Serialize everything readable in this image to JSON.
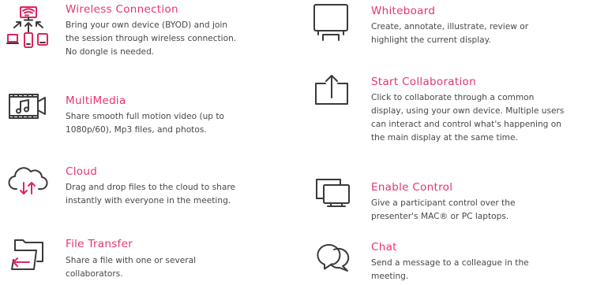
{
  "colors": {
    "accent": "#e0245e",
    "title": "#e8336d",
    "text": "#474747",
    "icon": "#3a3a3a"
  },
  "features": {
    "wireless": {
      "icon": "wireless-devices-icon",
      "title": "Wireless Connection",
      "lines": [
        "Bring your own device (BYOD) and join",
        "the session through wireless connection.",
        "No dongle is needed."
      ]
    },
    "multimedia": {
      "icon": "multimedia-icon",
      "title": "MultiMedia",
      "lines": [
        "Share smooth full motion video (up to",
        "1080p/60), Mp3 files, and photos."
      ]
    },
    "cloud": {
      "icon": "cloud-icon",
      "title": "Cloud",
      "lines": [
        "Drag and drop files to the cloud to share",
        "instantly with everyone in the meeting."
      ]
    },
    "file_transfer": {
      "icon": "folder-transfer-icon",
      "title": "File Transfer",
      "lines": [
        "Share a file with one or several",
        "collaborators."
      ]
    },
    "whiteboard": {
      "icon": "whiteboard-icon",
      "title": "Whiteboard",
      "lines": [
        "Create, annotate, illustrate, review or",
        "highlight the current display."
      ]
    },
    "start_collaboration": {
      "icon": "share-upload-icon",
      "title": "Start Collaboration",
      "lines": [
        "Click to collaborate through a common",
        "display, using your own device. Multiple users",
        "can interact and control what's happening on",
        "the main display at the same time."
      ]
    },
    "enable_control": {
      "icon": "screens-control-icon",
      "title": "Enable Control",
      "lines": [
        "Give a participant control over the",
        "presenter's MAC® or PC laptops."
      ]
    },
    "chat": {
      "icon": "chat-bubbles-icon",
      "title": "Chat",
      "lines": [
        "Send a message to a colleague in the",
        "meeting."
      ]
    }
  }
}
